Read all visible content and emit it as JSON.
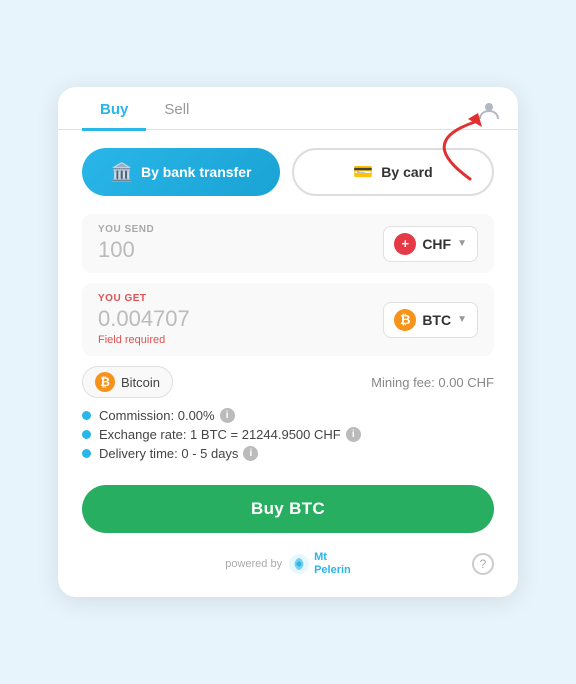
{
  "tabs": {
    "buy": "Buy",
    "sell": "Sell"
  },
  "payment": {
    "bank_transfer": "By bank transfer",
    "by_card": "By card"
  },
  "send": {
    "label": "YOU SEND",
    "value": "100"
  },
  "receive": {
    "label": "YOU GET",
    "value": "0.004707",
    "error": "Field required"
  },
  "currencies": {
    "chf": "CHF",
    "chf_symbol": "+",
    "btc": "BTC",
    "btc_symbol": "₿"
  },
  "coin": {
    "name": "Bitcoin"
  },
  "mining_fee": "Mining fee: 0.00 CHF",
  "details": {
    "commission": "Commission: 0.00%",
    "exchange_rate": "Exchange rate: 1 BTC = 21244.9500 CHF",
    "delivery_time": "Delivery time: 0 - 5 days"
  },
  "buy_button": "Buy BTC",
  "footer": {
    "powered_by": "powered by",
    "brand": "Mt\nPelerin"
  }
}
